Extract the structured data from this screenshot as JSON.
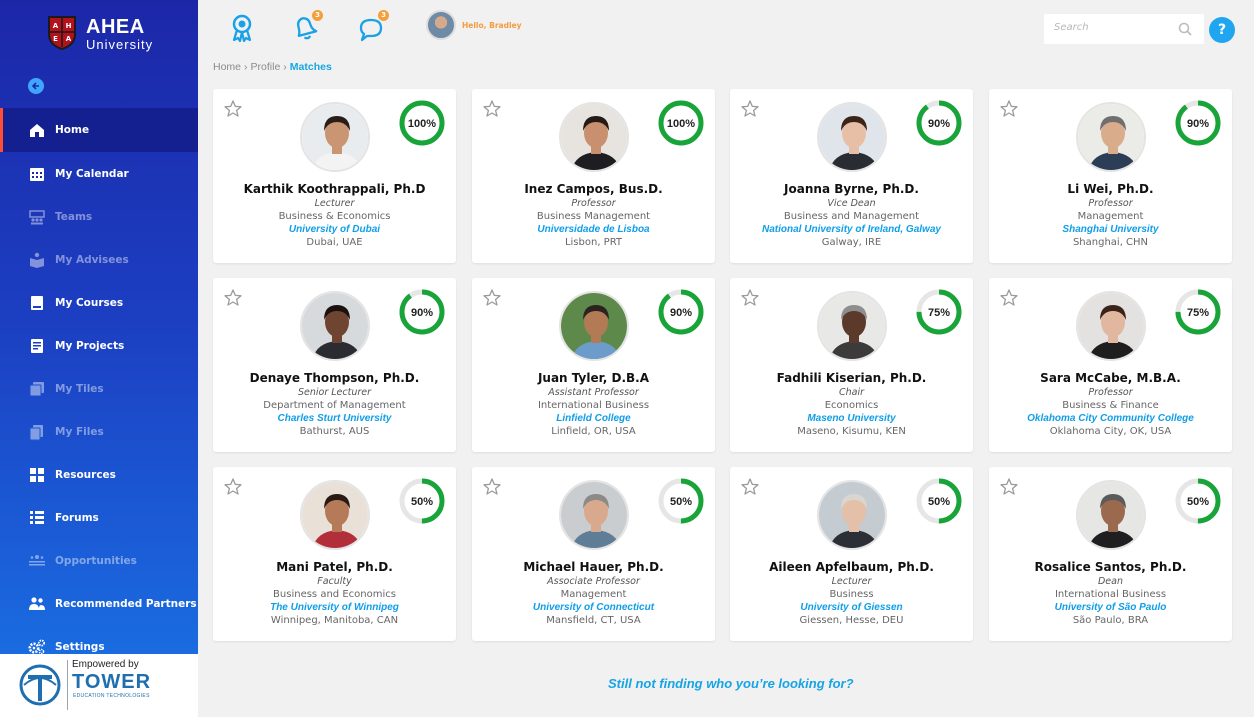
{
  "brand": {
    "name": "AHEA",
    "sub": "University",
    "shield_letters": [
      "A",
      "H",
      "E",
      "A"
    ]
  },
  "nav": [
    {
      "label": "Home",
      "icon": "home-icon",
      "active": true,
      "dim": false
    },
    {
      "label": "My Calendar",
      "icon": "calendar-icon",
      "active": false,
      "dim": false
    },
    {
      "label": "Teams",
      "icon": "teams-icon",
      "active": false,
      "dim": true
    },
    {
      "label": "My Advisees",
      "icon": "advisees-icon",
      "active": false,
      "dim": true
    },
    {
      "label": "My Courses",
      "icon": "courses-icon",
      "active": false,
      "dim": false
    },
    {
      "label": "My Projects",
      "icon": "projects-icon",
      "active": false,
      "dim": false
    },
    {
      "label": "My Tiles",
      "icon": "tiles-icon",
      "active": false,
      "dim": true
    },
    {
      "label": "My Files",
      "icon": "files-icon",
      "active": false,
      "dim": true
    },
    {
      "label": "Resources",
      "icon": "resources-icon",
      "active": false,
      "dim": false
    },
    {
      "label": "Forums",
      "icon": "forums-icon",
      "active": false,
      "dim": false
    },
    {
      "label": "Opportunities",
      "icon": "opportunities-icon",
      "active": false,
      "dim": true
    },
    {
      "label": "Recommended Partners",
      "icon": "partners-icon",
      "active": false,
      "dim": false
    },
    {
      "label": "Settings",
      "icon": "settings-icon",
      "active": false,
      "dim": false
    }
  ],
  "powered": {
    "top": "Empowered by",
    "name": "TOWER",
    "sub": "EDUCATION TECHNOLOGIES"
  },
  "topbar": {
    "notifications_count": "3",
    "messages_count": "3",
    "greeting": "Hello, Bradley",
    "search_placeholder": "Search",
    "help_label": "?"
  },
  "breadcrumb": {
    "items": [
      "Home",
      "Profile"
    ],
    "current": "Matches"
  },
  "matches": [
    {
      "name": "Karthik Koothrappali, Ph.D",
      "role": "Lecturer",
      "dept": "Business & Economics",
      "university": "University of Dubai",
      "location": "Dubai, UAE",
      "match": 100,
      "match_label": "100%",
      "skin": "#c99573",
      "hair": "#2a1d17",
      "shirt": "#f3f3f3",
      "bg": "#e9ecef"
    },
    {
      "name": "Inez Campos, Bus.D.",
      "role": "Professor",
      "dept": "Business Management",
      "university": "Universidade de Lisboa",
      "location": "Lisbon, PRT",
      "match": 100,
      "match_label": "100%",
      "skin": "#c8906f",
      "hair": "#241a16",
      "shirt": "#1e1e22",
      "bg": "#e7e3df"
    },
    {
      "name": "Joanna Byrne, Ph.D.",
      "role": "Vice Dean",
      "dept": "Business and Management",
      "university": "National University of Ireland, Galway",
      "location": "Galway, IRE",
      "match": 90,
      "match_label": "90%",
      "skin": "#e6bfa6",
      "hair": "#3b2418",
      "shirt": "#2a2c33",
      "bg": "#dfe5ea"
    },
    {
      "name": "Li Wei, Ph.D.",
      "role": "Professor",
      "dept": "Management",
      "university": "Shanghai University",
      "location": "Shanghai, CHN",
      "match": 90,
      "match_label": "90%",
      "skin": "#d9ac8c",
      "hair": "#6f6f6f",
      "shirt": "#2c3d57",
      "bg": "#ebebe8"
    },
    {
      "name": "Denaye Thompson, Ph.D.",
      "role": "Senior Lecturer",
      "dept": "Department of Management",
      "university": "Charles Sturt University",
      "location": "Bathurst, AUS",
      "match": 90,
      "match_label": "90%",
      "skin": "#6f4532",
      "hair": "#1b1210",
      "shirt": "#2b2c31",
      "bg": "#d7dadd"
    },
    {
      "name": "Juan Tyler, D.B.A",
      "role": "Assistant Professor",
      "dept": "International Business",
      "university": "Linfield College",
      "location": "Linfield, OR, USA",
      "match": 90,
      "match_label": "90%",
      "skin": "#b27a55",
      "hair": "#2b2320",
      "shirt": "#6c9cc9",
      "bg": "#5d8a4a"
    },
    {
      "name": "Fadhili Kiserian, Ph.D.",
      "role": "Chair",
      "dept": "Economics",
      "university": "Maseno University",
      "location": "Maseno, Kisumu, KEN",
      "match": 75,
      "match_label": "75%",
      "skin": "#5b3a2b",
      "hair": "#8e8e8e",
      "shirt": "#3c3a3a",
      "bg": "#e8e8e6"
    },
    {
      "name": "Sara McCabe, M.B.A.",
      "role": "Professor",
      "dept": "Business & Finance",
      "university": "Oklahoma City Community College",
      "location": "Oklahoma City, OK, USA",
      "match": 75,
      "match_label": "75%",
      "skin": "#e2b7a0",
      "hair": "#3b231a",
      "shirt": "#1e1e1e",
      "bg": "#e4e2e0"
    },
    {
      "name": "Mani Patel, Ph.D.",
      "role": "Faculty",
      "dept": "Business and Economics",
      "university": "The University of Winnipeg",
      "location": "Winnipeg, Manitoba, CAN",
      "match": 50,
      "match_label": "50%",
      "skin": "#b57a58",
      "hair": "#2a1a14",
      "shirt": "#b22f3a",
      "bg": "#e9e1d8"
    },
    {
      "name": "Michael Hauer, Ph.D.",
      "role": "Associate Professor",
      "dept": "Management",
      "university": "University of Connecticut",
      "location": "Mansfield, CT, USA",
      "match": 50,
      "match_label": "50%",
      "skin": "#d8a98c",
      "hair": "#8c8a86",
      "shirt": "#5f7d96",
      "bg": "#c9cdd0"
    },
    {
      "name": "Aileen Apfelbaum, Ph.D.",
      "role": "Lecturer",
      "dept": "Business",
      "university": "University of Giessen",
      "location": "Giessen, Hesse, DEU",
      "match": 50,
      "match_label": "50%",
      "skin": "#e5c0a8",
      "hair": "#d9d6d2",
      "shirt": "#2c2f36",
      "bg": "#c4ccd2"
    },
    {
      "name": "Rosalice Santos, Ph.D.",
      "role": "Dean",
      "dept": "International Business",
      "university": "University of São Paulo",
      "location": "São Paulo, BRA",
      "match": 50,
      "match_label": "50%",
      "skin": "#9b6a4e",
      "hair": "#5b5b5b",
      "shirt": "#1f1f22",
      "bg": "#e6e6e4"
    }
  ],
  "footer_link": "Still not finding who you’re looking for?",
  "colors": {
    "accent": "#17a6e0",
    "ring": "#19a43a",
    "ring_track": "#e6e6e6",
    "badge": "#f4a03a",
    "active_border": "#ff4d36"
  }
}
